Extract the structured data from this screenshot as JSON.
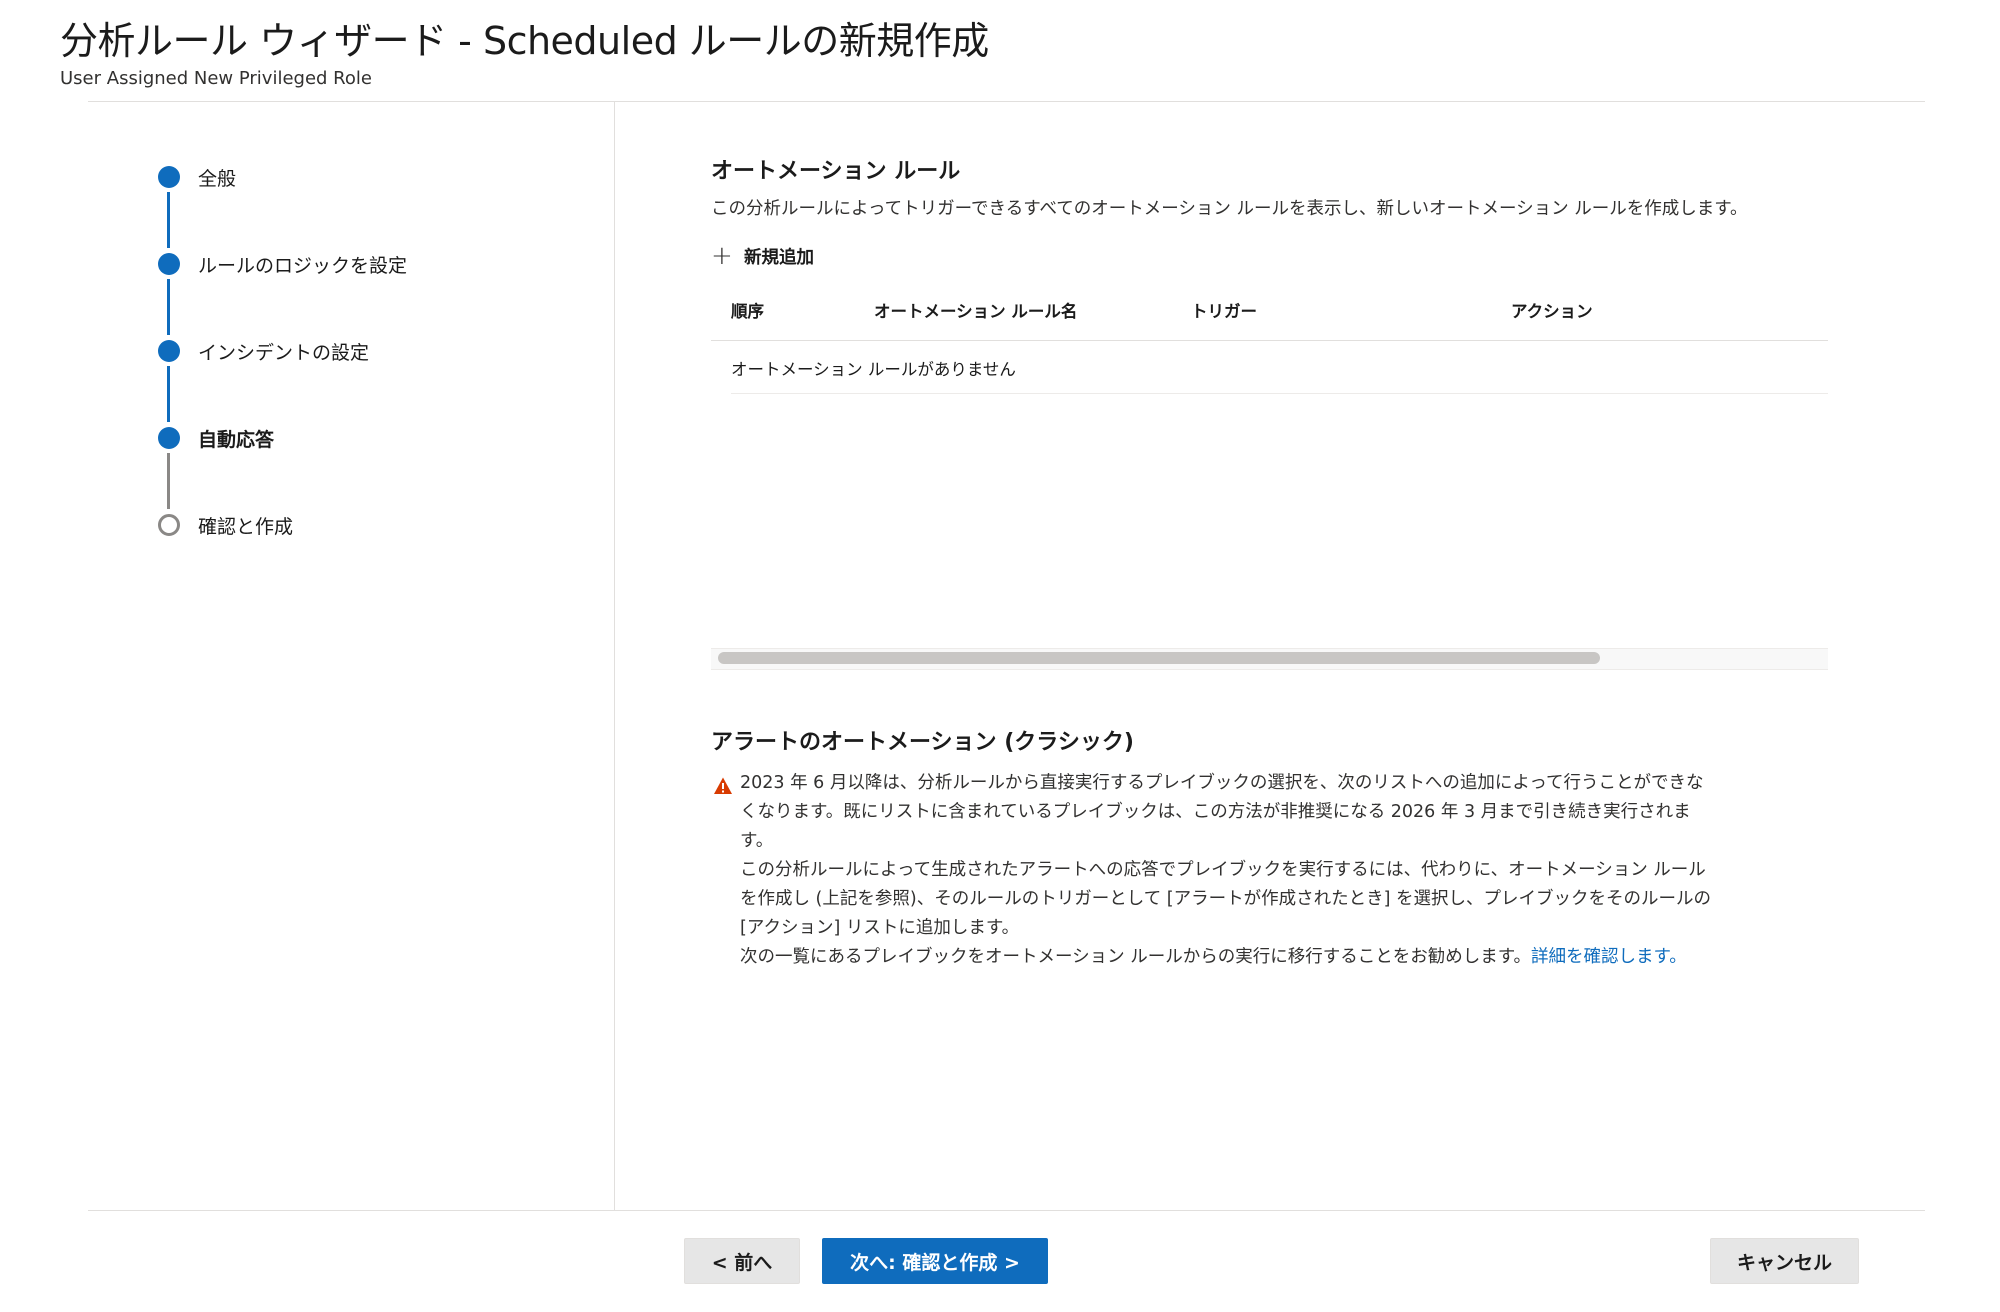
{
  "header": {
    "title": "分析ルール ウィザード - Scheduled ルールの新規作成",
    "subtitle": "User Assigned New Privileged Role"
  },
  "steps": [
    {
      "label": "全般",
      "state": "completed"
    },
    {
      "label": "ルールのロジックを設定",
      "state": "completed"
    },
    {
      "label": "インシデントの設定",
      "state": "completed"
    },
    {
      "label": "自動応答",
      "state": "current"
    },
    {
      "label": "確認と作成",
      "state": "pending"
    }
  ],
  "automation": {
    "heading": "オートメーション ルール",
    "description": "この分析ルールによってトリガーできるすべてのオートメーション ルールを表示し、新しいオートメーション ルールを作成します。",
    "add_label": "新規追加",
    "columns": [
      "順序",
      "オートメーション ルール名",
      "トリガー",
      "アクション"
    ],
    "empty_message": "オートメーション ルールがありません"
  },
  "classic": {
    "heading": "アラートのオートメーション (クラシック)",
    "warning_p1": "2023 年 6 月以降は、分析ルールから直接実行するプレイブックの選択を、次のリストへの追加によって行うことができなくなります。既にリストに含まれているプレイブックは、この方法が非推奨になる 2026 年 3 月まで引き続き実行されます。",
    "warning_p2": "この分析ルールによって生成されたアラートへの応答でプレイブックを実行するには、代わりに、オートメーション ルールを作成し (上記を参照)、そのルールのトリガーとして [アラートが作成されたとき] を選択し、プレイブックをそのルールの [アクション] リストに追加します。",
    "warning_p3": "次の一覧にあるプレイブックをオートメーション ルールからの実行に移行することをお勧めします。",
    "learn_more": "詳細を確認します。"
  },
  "footer": {
    "prev_label": "< 前へ",
    "next_label": "次へ: 確認と作成 >",
    "cancel_label": "キャンセル"
  },
  "colors": {
    "accent": "#0f6cbd",
    "warning": "#d83b01",
    "inactive": "#8a8886"
  }
}
